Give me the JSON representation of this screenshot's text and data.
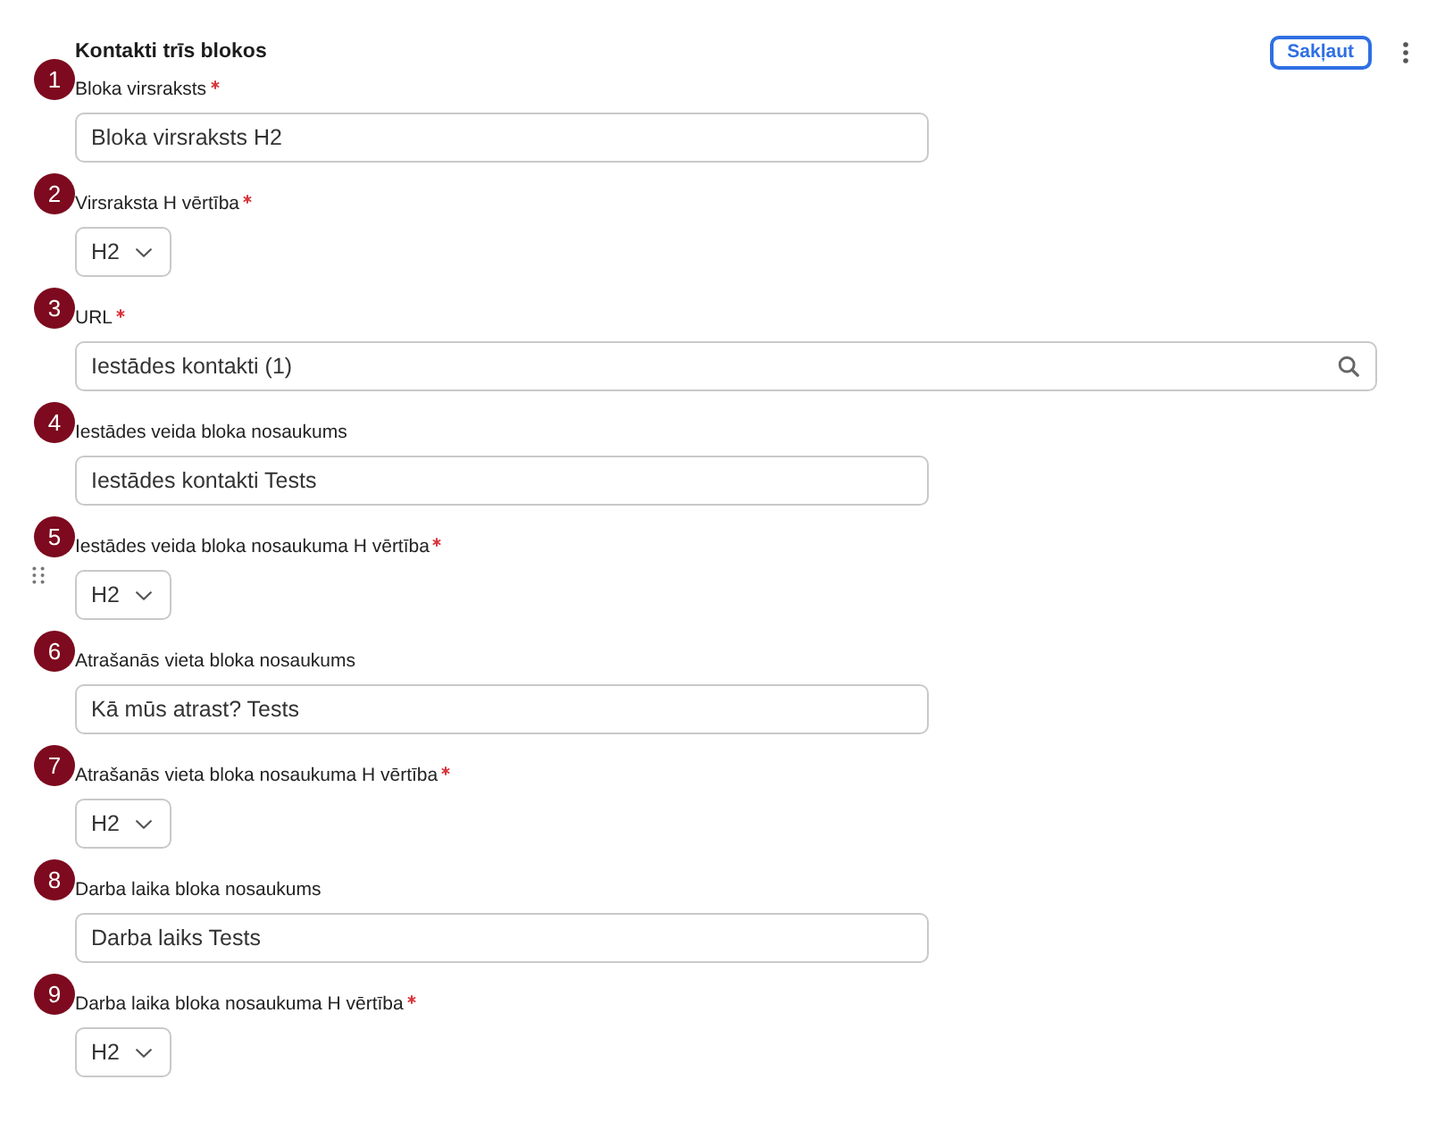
{
  "header": {
    "title": "Kontakti trīs blokos",
    "collapse_button": "Sakļaut"
  },
  "fields": [
    {
      "number": "1",
      "label": "Bloka virsraksts",
      "required": true,
      "kind": "text",
      "value": "Bloka virsraksts H2",
      "drag_handle": false
    },
    {
      "number": "2",
      "label": "Virsraksta H vērtība",
      "required": true,
      "kind": "select",
      "value": "H2",
      "drag_handle": false
    },
    {
      "number": "3",
      "label": "URL",
      "required": true,
      "kind": "search",
      "value": "Iestādes kontakti (1)",
      "drag_handle": false
    },
    {
      "number": "4",
      "label": "Iestādes veida bloka nosaukums",
      "required": false,
      "kind": "text",
      "value": "Iestādes kontakti Tests",
      "drag_handle": false
    },
    {
      "number": "5",
      "label": "Iestādes veida bloka nosaukuma H vērtība",
      "required": true,
      "kind": "select",
      "value": "H2",
      "drag_handle": true
    },
    {
      "number": "6",
      "label": "Atrašanās vieta bloka nosaukums",
      "required": false,
      "kind": "text",
      "value": "Kā mūs atrast? Tests",
      "drag_handle": false
    },
    {
      "number": "7",
      "label": "Atrašanās vieta bloka nosaukuma H vērtība",
      "required": true,
      "kind": "select",
      "value": "H2",
      "drag_handle": false
    },
    {
      "number": "8",
      "label": "Darba laika bloka nosaukums",
      "required": false,
      "kind": "text",
      "value": "Darba laiks Tests",
      "drag_handle": false
    },
    {
      "number": "9",
      "label": "Darba laika bloka nosaukuma H vērtība",
      "required": true,
      "kind": "select",
      "value": "H2",
      "drag_handle": false
    }
  ]
}
